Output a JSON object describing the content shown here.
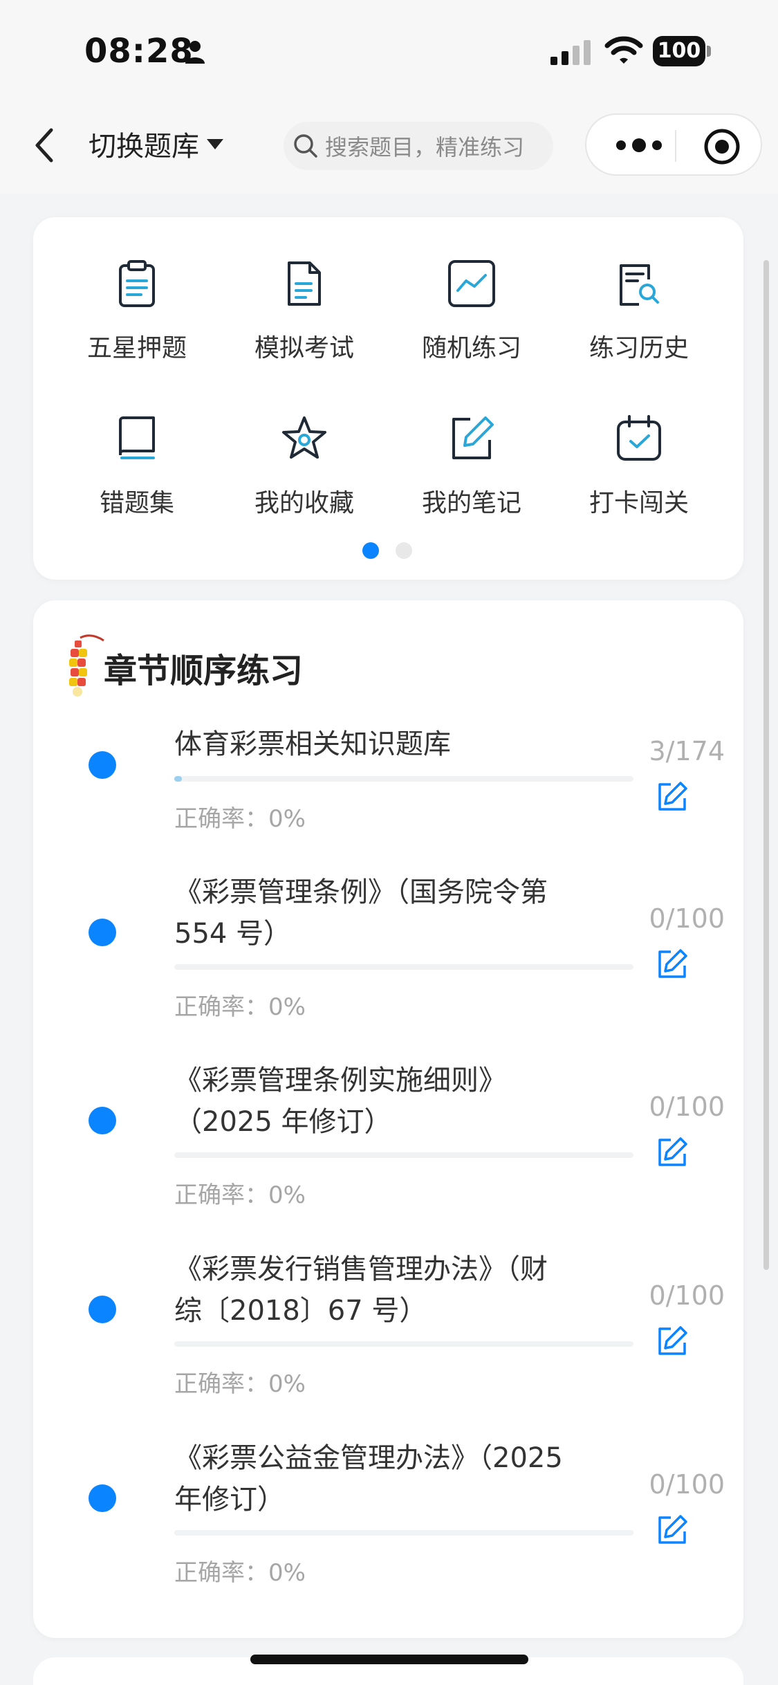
{
  "status_bar": {
    "time": "08:28",
    "battery": "100"
  },
  "nav": {
    "switch_label": "切换题库",
    "search_placeholder": "搜索题目，精准练习"
  },
  "grid": {
    "items": [
      {
        "label": "五星押题",
        "icon": "clipboard-icon"
      },
      {
        "label": "模拟考试",
        "icon": "document-icon"
      },
      {
        "label": "随机练习",
        "icon": "chart-line-icon"
      },
      {
        "label": "练习历史",
        "icon": "history-search-icon"
      },
      {
        "label": "错题集",
        "icon": "book-icon"
      },
      {
        "label": "我的收藏",
        "icon": "star-icon"
      },
      {
        "label": "我的笔记",
        "icon": "note-edit-icon"
      },
      {
        "label": "打卡闯关",
        "icon": "calendar-check-icon"
      }
    ],
    "page_indicator": {
      "active": 1,
      "total": 2
    }
  },
  "chapters": {
    "title": "章节顺序练习",
    "items": [
      {
        "title_lines": [
          "体育彩票相关知识题库"
        ],
        "progress": 0.017,
        "accuracy": "正确率：0%",
        "count": "3/174"
      },
      {
        "title_lines": [
          "《彩票管理条例》（国务院令第",
          "554 号）"
        ],
        "progress": 0,
        "accuracy": "正确率：0%",
        "count": "0/100"
      },
      {
        "title_lines": [
          "《彩票管理条例实施细则》",
          "（2025 年修订）"
        ],
        "progress": 0,
        "accuracy": "正确率：0%",
        "count": "0/100"
      },
      {
        "title_lines": [
          "《彩票发行销售管理办法》（财",
          "综〔2018〕67 号）"
        ],
        "progress": 0,
        "accuracy": "正确率：0%",
        "count": "0/100"
      },
      {
        "title_lines": [
          "《彩票公益金管理办法》（2025",
          "年修订）"
        ],
        "progress": 0,
        "accuracy": "正确率：0%",
        "count": "0/100"
      }
    ]
  },
  "colors": {
    "accent": "#0a84ff",
    "icon_stroke": "#1f2a36",
    "icon_accent": "#2aa7d9",
    "progress_fill": "#9dd0ee"
  }
}
